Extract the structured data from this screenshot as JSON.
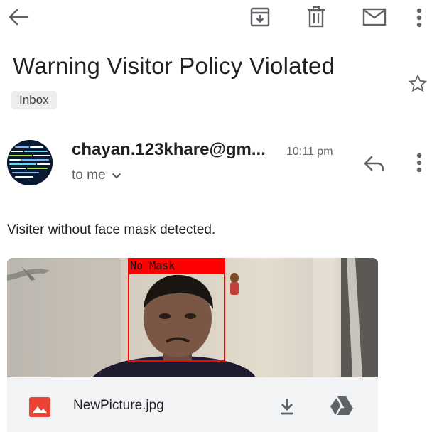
{
  "toolbar": {
    "back": "arrow-left-icon",
    "archive": "archive-icon",
    "delete": "trash-icon",
    "mark_unread": "mail-icon",
    "more": "more-vert-icon"
  },
  "email": {
    "subject": "Warning Visitor Policy Violated",
    "label": "Inbox",
    "sender": "chayan.123khare@gm...",
    "time": "10:11 pm",
    "recipient": "to me",
    "body": "Visiter without face mask detected."
  },
  "attachment": {
    "detection_label": "No Mask",
    "filename": "NewPicture.jpg"
  },
  "colors": {
    "detection_box": "#ff0000",
    "image_file_icon": "#ea4335",
    "drive_icon": "#5f6368"
  }
}
